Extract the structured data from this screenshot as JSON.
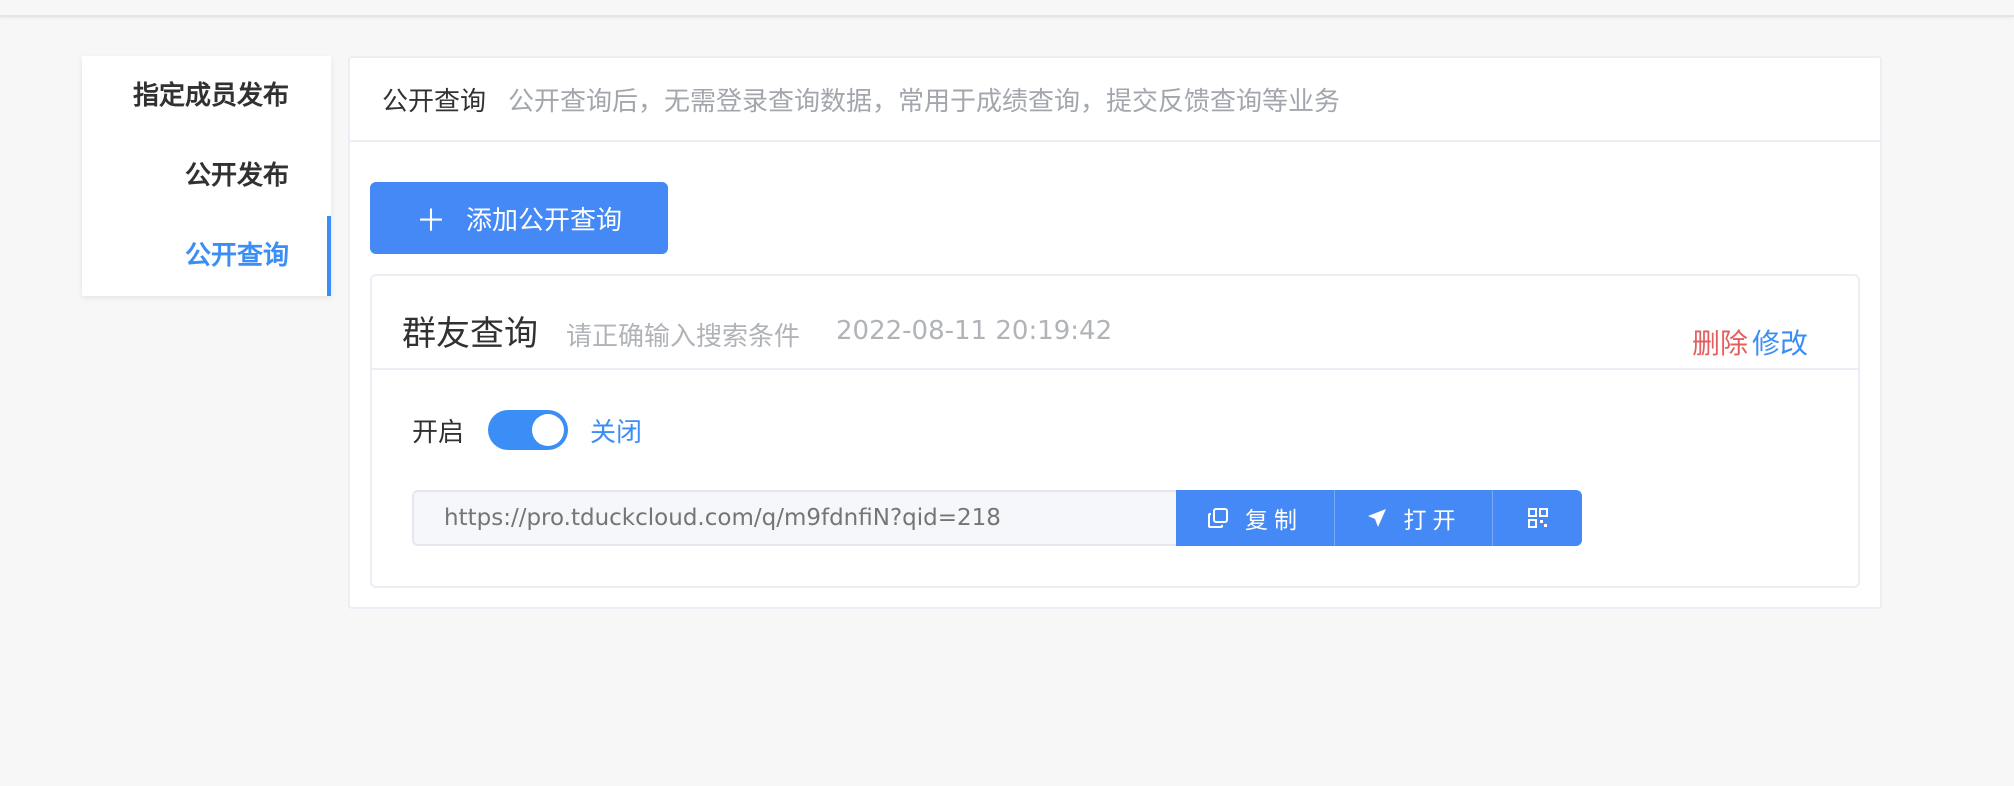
{
  "side_tabs": [
    {
      "label": "指定成员发布",
      "active": false
    },
    {
      "label": "公开发布",
      "active": false
    },
    {
      "label": "公开查询",
      "active": true
    }
  ],
  "main": {
    "title": "公开查询",
    "description": "公开查询后，无需登录查询数据，常用于成绩查询，提交反馈查询等业务",
    "add_button_label": "添加公开查询"
  },
  "query_item": {
    "name": "群友查询",
    "hint": "请正确输入搜索条件",
    "timestamp": "2022-08-11 20:19:42",
    "delete_label": "删除",
    "edit_label": "修改",
    "switch_label": "开启",
    "switch_state_label": "关闭",
    "url_placeholder": "https://pro.tduckcloud.com/q/m9fdnfiN?qid=218",
    "copy_label": "复制",
    "open_label": "打开"
  },
  "colors": {
    "accent": "#3a8ef6",
    "danger": "#e35f5f",
    "background": "#f7f7f8"
  },
  "icons": [
    "plus-icon",
    "copy-icon",
    "send-icon",
    "qrcode-icon"
  ]
}
